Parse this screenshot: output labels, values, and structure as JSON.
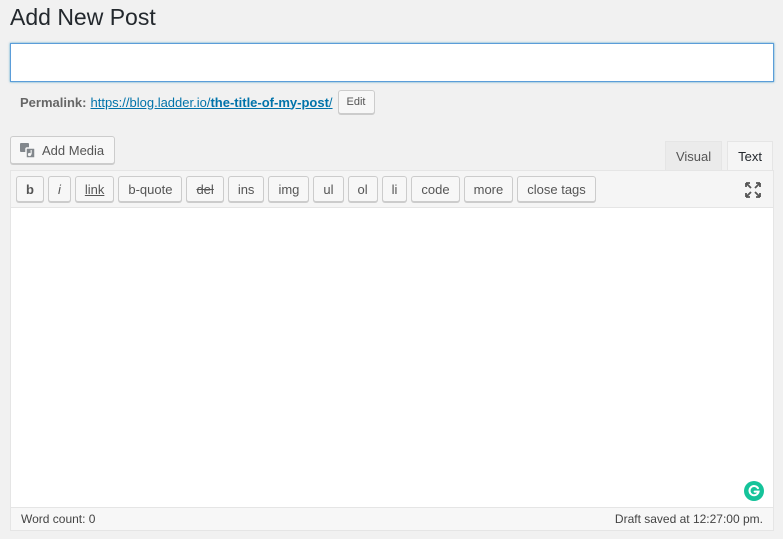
{
  "page": {
    "title": "Add New Post"
  },
  "title_field": {
    "value": "",
    "placeholder": ""
  },
  "permalink": {
    "label": "Permalink:",
    "base_url": "https://blog.ladder.io/",
    "slug": "the-title-of-my-post",
    "trailing": "/",
    "edit_label": "Edit"
  },
  "media": {
    "add_media_label": "Add Media",
    "icon": "media-icon"
  },
  "tabs": [
    {
      "label": "Visual",
      "active": false
    },
    {
      "label": "Text",
      "active": true
    }
  ],
  "quicktags": [
    {
      "label": "b"
    },
    {
      "label": "i"
    },
    {
      "label": "link"
    },
    {
      "label": "b-quote"
    },
    {
      "label": "del"
    },
    {
      "label": "ins"
    },
    {
      "label": "img"
    },
    {
      "label": "ul"
    },
    {
      "label": "ol"
    },
    {
      "label": "li"
    },
    {
      "label": "code"
    },
    {
      "label": "more"
    },
    {
      "label": "close tags"
    }
  ],
  "editor": {
    "content": ""
  },
  "status": {
    "word_count": "Word count: 0",
    "draft_saved": "Draft saved at 12:27:00 pm."
  },
  "colors": {
    "link": "#0073aa",
    "focus_border": "#5b9dd9",
    "grammarly": "#15c39a"
  }
}
